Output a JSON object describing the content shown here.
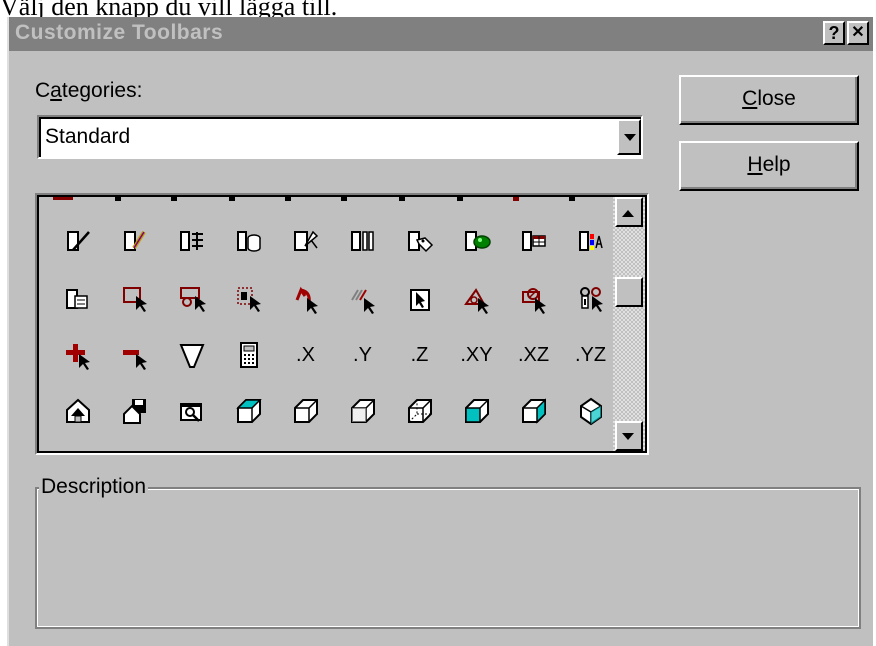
{
  "above_text": "Välj den knapp du vill lägga till.",
  "dialog": {
    "title": "Customize Toolbars",
    "help_glyph": "?",
    "close_glyph": "✕"
  },
  "categories": {
    "label_pre": "C",
    "label_underlined": "a",
    "label_post": "tegories:",
    "selected": "Standard"
  },
  "buttons": {
    "close_underlined": "C",
    "close_rest": "lose",
    "help_underlined": "H",
    "help_rest": "elp"
  },
  "icon_grid": {
    "rows": [
      [
        "pencil-edit-icon",
        "design-pencil-icon",
        "field-list-icon",
        "database-icon",
        "wizard-icon",
        "columns-icon",
        "tag-icon",
        "properties-ball-icon",
        "table-grid-icon",
        "color-table-icon"
      ],
      [
        "form-icon",
        "select-region-icon",
        "select-zoom-icon",
        "dotted-select-icon",
        "undo-arrow-icon",
        "hatch-select-icon",
        "pointer-box-icon",
        "select-angle-icon",
        "zoom-select-icon",
        "binoculars-icon"
      ],
      [
        "add-red-icon",
        "subtract-red-icon",
        "filter-funnel-icon",
        "calculator-icon",
        "x-axis-text",
        "y-axis-text",
        "z-axis-text",
        "xy-axis-text",
        "xz-axis-text",
        "yz-axis-text"
      ],
      [
        "house-save-icon",
        "house-disk-icon",
        "zoom-window-icon",
        "cube-1-icon",
        "cube-2-icon",
        "cube-3-icon",
        "cube-4-icon",
        "cube-5-icon",
        "cube-6-icon",
        "diamond-view-icon"
      ]
    ],
    "axis_labels": {
      "x": ".X",
      "y": ".Y",
      "z": ".Z",
      "xy": ".XY",
      "xz": ".XZ",
      "yz": ".YZ"
    },
    "scroll_fraction": 0.33
  },
  "description": {
    "label": "Description",
    "text": ""
  }
}
